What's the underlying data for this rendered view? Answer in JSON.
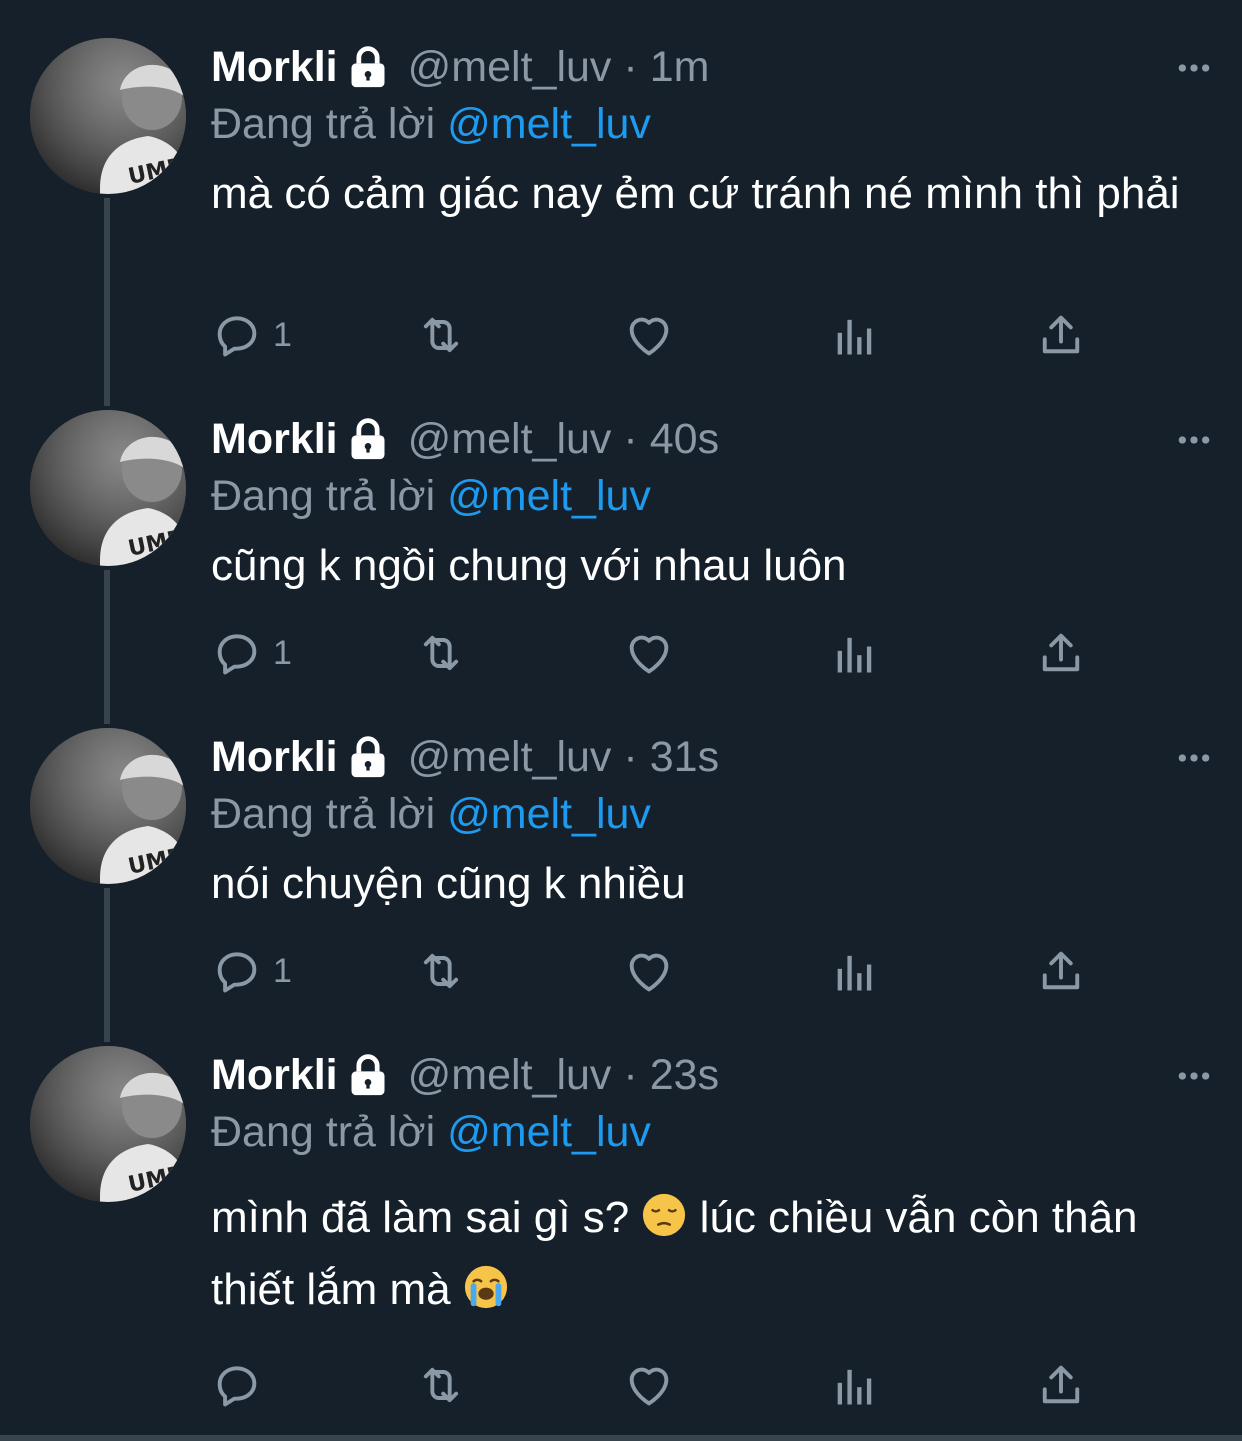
{
  "colors": {
    "background": "#15202b",
    "secondary_text": "#8b98a5",
    "link": "#1d9bf0",
    "thread_line": "#38444d"
  },
  "reply_prefix": "Đang trả lời",
  "tweets": [
    {
      "name": "Morkli",
      "handle": "@melt_luv",
      "separator": "·",
      "time": "1m",
      "replying_to": "@melt_luv",
      "text": "mà có cảm giác nay ẻm cứ tránh né mình thì phải",
      "reply_count": "1"
    },
    {
      "name": "Morkli",
      "handle": "@melt_luv",
      "separator": "·",
      "time": "40s",
      "replying_to": "@melt_luv",
      "text": "cũng k ngồi chung với nhau luôn",
      "reply_count": "1"
    },
    {
      "name": "Morkli",
      "handle": "@melt_luv",
      "separator": "·",
      "time": "31s",
      "replying_to": "@melt_luv",
      "text": "nói chuyện cũng k nhiều",
      "reply_count": "1"
    },
    {
      "name": "Morkli",
      "handle": "@melt_luv",
      "separator": "·",
      "time": "23s",
      "replying_to": "@melt_luv",
      "text_part1": "mình đã làm sai gì s?",
      "emoji1": "pensive-face",
      "text_part2": "lúc chiều vẫn còn thân thiết lắm mà",
      "emoji2": "loudly-crying-face",
      "reply_count": ""
    }
  ],
  "icons": {
    "lock": "lock-icon",
    "more": "more-icon",
    "reply": "reply-icon",
    "retweet": "retweet-icon",
    "like": "like-icon",
    "views": "views-icon",
    "share": "share-icon"
  }
}
